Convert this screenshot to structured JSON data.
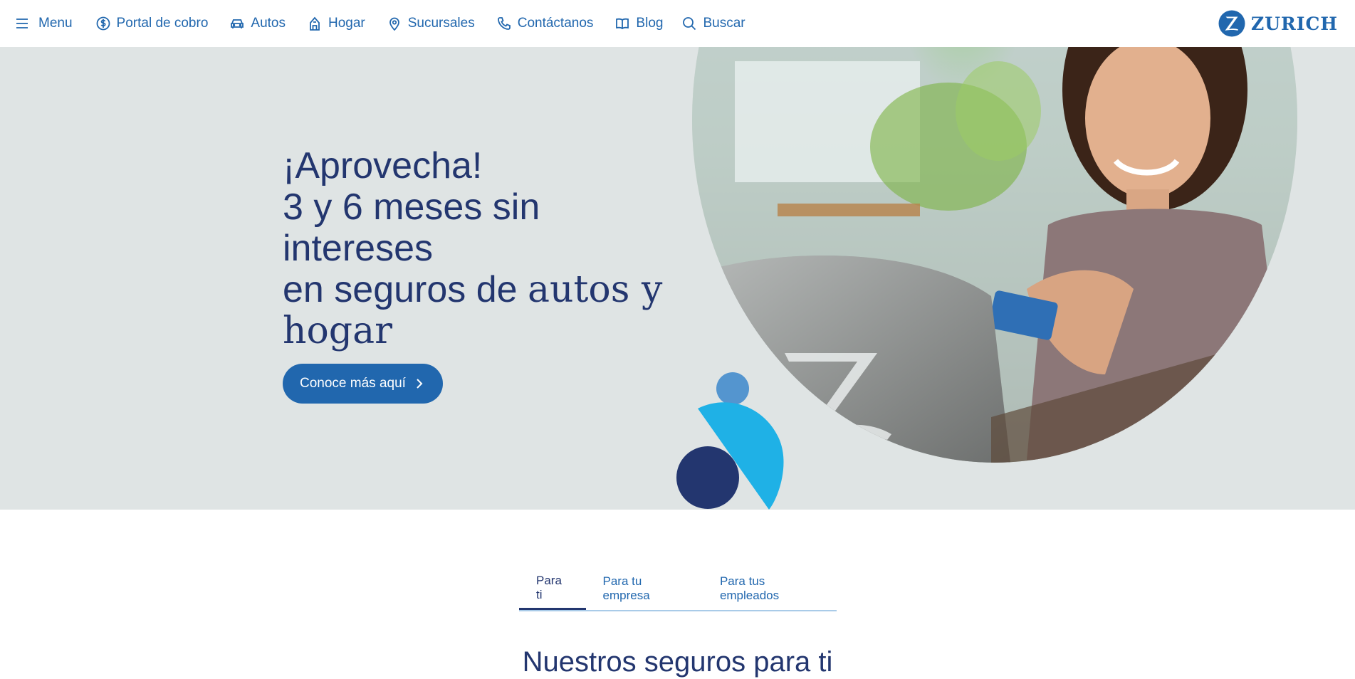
{
  "nav": {
    "menu": "Menu",
    "items": [
      {
        "label": "Portal de cobro",
        "icon": "dollar-circle-icon"
      },
      {
        "label": "Autos",
        "icon": "car-icon"
      },
      {
        "label": "Hogar",
        "icon": "home-icon"
      },
      {
        "label": "Sucursales",
        "icon": "location-pin-icon"
      },
      {
        "label": "Contáctanos",
        "icon": "phone-icon"
      },
      {
        "label": "Blog",
        "icon": "book-icon"
      },
      {
        "label": "Buscar",
        "icon": "search-icon"
      }
    ],
    "brand": "ZURICH"
  },
  "hero": {
    "headline_1": "¡Aprovecha!",
    "headline_2": "3 y 6 meses sin intereses",
    "headline_3a": "en seguros de ",
    "headline_3b": "autos y",
    "headline_4": "hogar",
    "cta_label": "Conoce más aquí"
  },
  "tabs": [
    {
      "label": "Para ti",
      "active": true
    },
    {
      "label": "Para tu empresa",
      "active": false
    },
    {
      "label": "Para tus empleados",
      "active": false
    }
  ],
  "section_title": "Nuestros seguros para ti",
  "colors": {
    "primary_blue": "#2167ae",
    "navy": "#23366f",
    "hero_bg": "#dfe4e4",
    "light_blue": "#1fb1e6",
    "mid_blue": "#5495cf"
  }
}
